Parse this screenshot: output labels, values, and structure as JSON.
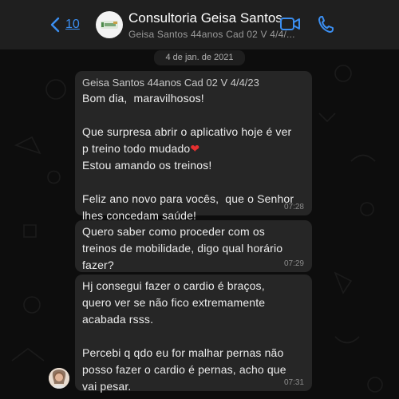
{
  "header": {
    "back_count": "10",
    "chat_name": "Consultoria Geisa Santos",
    "chat_subtitle": "Geisa Santos 44anos Cad 02 V 4/4/...",
    "avatar_text": "Geisa"
  },
  "date_separator": "4 de jan. de 2021",
  "messages": [
    {
      "sender": "Geisa Santos 44anos Cad 02 V 4/4/23",
      "text_before": "Bom dia,  maravilhosos!\n\nQue surpresa abrir o aplicativo hoje é ver\np treino todo mudado",
      "emoji": "❤",
      "text_after": "\nEstou amando os treinos!\n\nFeliz ano novo para vocês,  que o Senhor\nlhes concedam saúde!",
      "time": "07:28"
    },
    {
      "text": "Quero saber como proceder com os\ntreinos de mobilidade, digo qual horário\nfazer?",
      "time": "07:29"
    },
    {
      "text": "Hj consegui fazer o cardio é braços,\nquero ver se não fico extremamente\nacabada rsss.\n\nPercebi q qdo eu for malhar pernas não\nposso fazer o cardio é pernas, acho que\nvai pesar.",
      "time": "07:31"
    }
  ],
  "colors": {
    "accent": "#3b8ef0",
    "bubble": "#262626",
    "header": "#1f1f1f",
    "background": "#0d0d0d"
  },
  "icons": {
    "back": "chevron-left-icon",
    "video": "video-call-icon",
    "phone": "phone-icon"
  }
}
